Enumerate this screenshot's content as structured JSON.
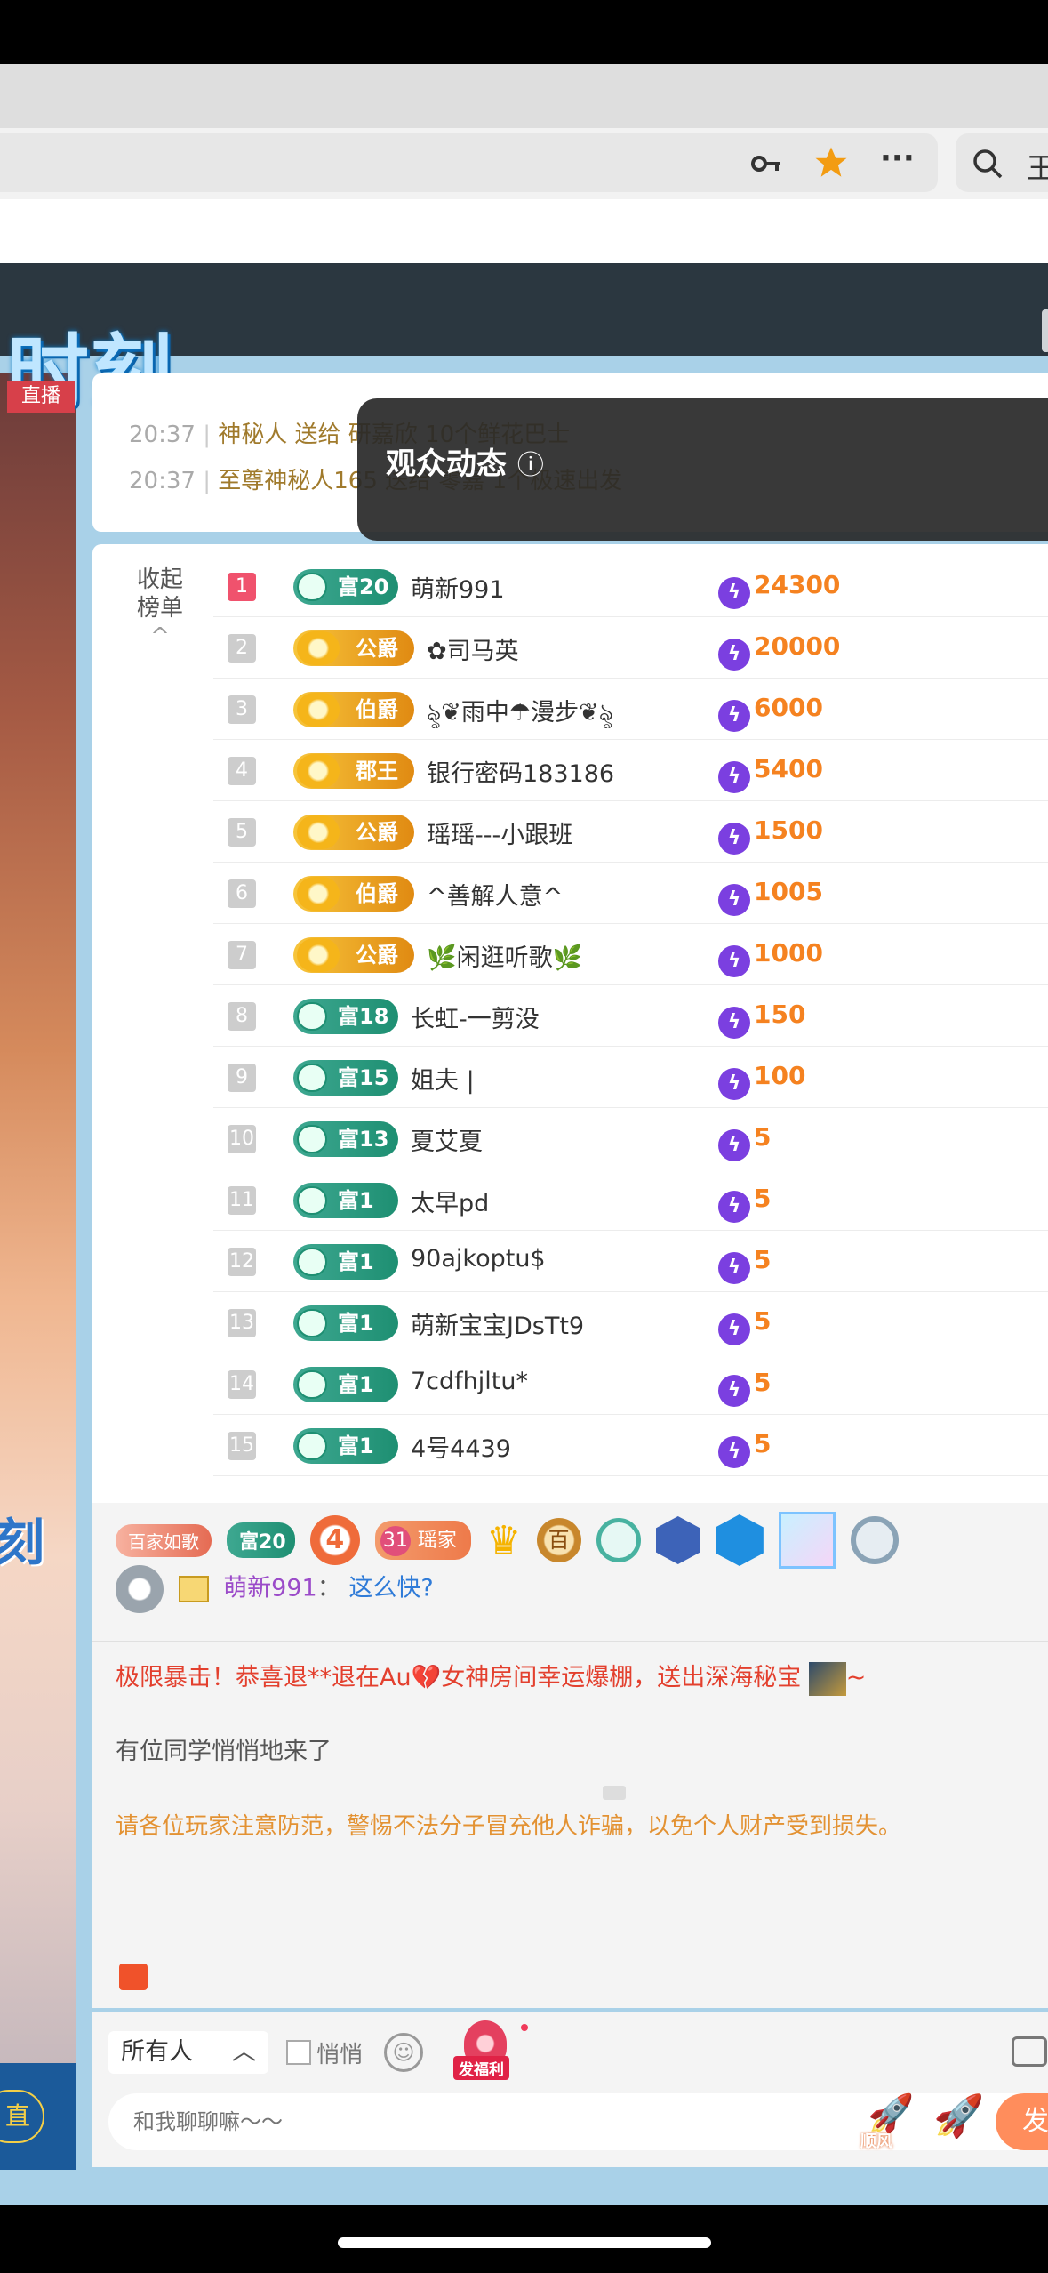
{
  "toolbar": {
    "key_icon": "key-icon",
    "star_icon": "star-icon",
    "more_label": "···",
    "search_partial": "王"
  },
  "stream": {
    "title_art": "时刻",
    "live_tag": "直播",
    "side_art": "刻",
    "follow_partial": "直"
  },
  "gifts": [
    {
      "time": "20:37",
      "text": "神秘人 送给 研嘉欣 10个鲜花巴士"
    },
    {
      "time": "20:37",
      "text": "至尊神秘人165 送给 零嘉 1个极速出发"
    }
  ],
  "audience_popup": {
    "title": "观众动态",
    "info_icon": "ⓘ"
  },
  "rank": {
    "collapse_label_1": "收起",
    "collapse_label_2": "榜单",
    "collapse_caret": "^",
    "rows": [
      {
        "rank": "1",
        "badge": "富20",
        "type": "green",
        "name": "萌新991",
        "score": "24300"
      },
      {
        "rank": "2",
        "badge": "公爵",
        "type": "gold",
        "name": "✿司马英",
        "score": "20000"
      },
      {
        "rank": "3",
        "badge": "伯爵",
        "type": "gold",
        "name": "ৡ❦雨中☂漫步❦ৡ",
        "score": "6000"
      },
      {
        "rank": "4",
        "badge": "郡王",
        "type": "gold",
        "name": "银行密码183186",
        "score": "5400"
      },
      {
        "rank": "5",
        "badge": "公爵",
        "type": "gold",
        "name": "瑶瑶---小跟班",
        "score": "1500"
      },
      {
        "rank": "6",
        "badge": "伯爵",
        "type": "gold",
        "name": "^善解人意^",
        "score": "1005"
      },
      {
        "rank": "7",
        "badge": "公爵",
        "type": "gold",
        "name": "🌿闲逛听歌🌿",
        "score": "1000"
      },
      {
        "rank": "8",
        "badge": "富18",
        "type": "green",
        "name": "长虹-一剪没",
        "score": "150"
      },
      {
        "rank": "9",
        "badge": "富15",
        "type": "green",
        "name": "姐夫 |",
        "score": "100"
      },
      {
        "rank": "10",
        "badge": "富13",
        "type": "green",
        "name": "夏艾夏",
        "score": "5"
      },
      {
        "rank": "11",
        "badge": "富1",
        "type": "green",
        "name": "太早pd",
        "score": "5"
      },
      {
        "rank": "12",
        "badge": "富1",
        "type": "green",
        "name": "90ajkoptu$",
        "score": "5"
      },
      {
        "rank": "13",
        "badge": "富1",
        "type": "green",
        "name": "萌新宝宝JDsTt9",
        "score": "5"
      },
      {
        "rank": "14",
        "badge": "富1",
        "type": "green",
        "name": "7cdfhjltu*",
        "score": "5"
      },
      {
        "rank": "15",
        "badge": "富1",
        "type": "green",
        "name": "4号4439",
        "score": "5"
      }
    ]
  },
  "chat": {
    "medals": {
      "m1": "百家如歌",
      "m2": "富20",
      "m3": "4",
      "m4_num": "31",
      "m4_text": "瑶家",
      "m5": "百"
    },
    "line1_user": "萌新991",
    "line1_sep": "：",
    "line1_msg": "这么快?",
    "line2": "极限暴击！恭喜退**退在Au💔女神房间幸运爆棚，送出深海秘宝",
    "line2_end": "~",
    "line3": "有位同学悄悄地来了",
    "notice": "请各位玩家注意防范，警惕不法分子冒充他人诈骗，以免个人财产受到损失。"
  },
  "input": {
    "target": "所有人",
    "quiet_label": "悄悄",
    "bag_label": "发福利",
    "placeholder": "和我聊聊嘛～～",
    "rocket1_label": "顺风",
    "send_partial": "发"
  },
  "colors": {
    "accent_orange": "#f58220",
    "rank_first": "#f0526d",
    "bolt": "#7b3fe0"
  }
}
